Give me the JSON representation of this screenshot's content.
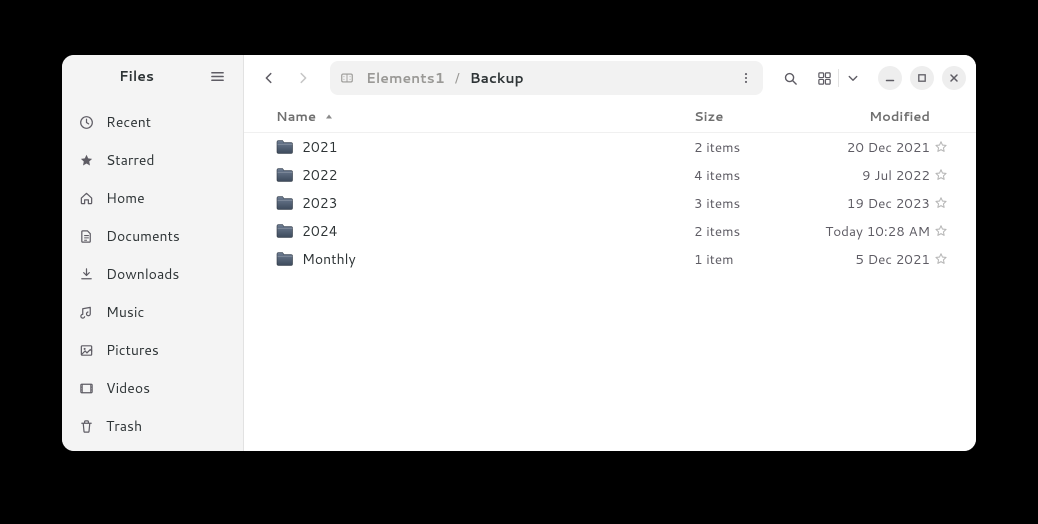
{
  "sidebar": {
    "title": "Files",
    "items": [
      {
        "label": "Recent"
      },
      {
        "label": "Starred"
      },
      {
        "label": "Home"
      },
      {
        "label": "Documents"
      },
      {
        "label": "Downloads"
      },
      {
        "label": "Music"
      },
      {
        "label": "Pictures"
      },
      {
        "label": "Videos"
      },
      {
        "label": "Trash"
      }
    ]
  },
  "breadcrumb": {
    "root": "Elements1",
    "current": "Backup"
  },
  "columns": {
    "name": "Name",
    "size": "Size",
    "modified": "Modified"
  },
  "rows": [
    {
      "name": "2021",
      "size": "2 items",
      "modified": "20 Dec 2021"
    },
    {
      "name": "2022",
      "size": "4 items",
      "modified": "9 Jul 2022"
    },
    {
      "name": "2023",
      "size": "3 items",
      "modified": "19 Dec 2023"
    },
    {
      "name": "2024",
      "size": "2 items",
      "modified": "Today 10:28 AM"
    },
    {
      "name": "Monthly",
      "size": "1 item",
      "modified": "5 Dec 2021"
    }
  ]
}
